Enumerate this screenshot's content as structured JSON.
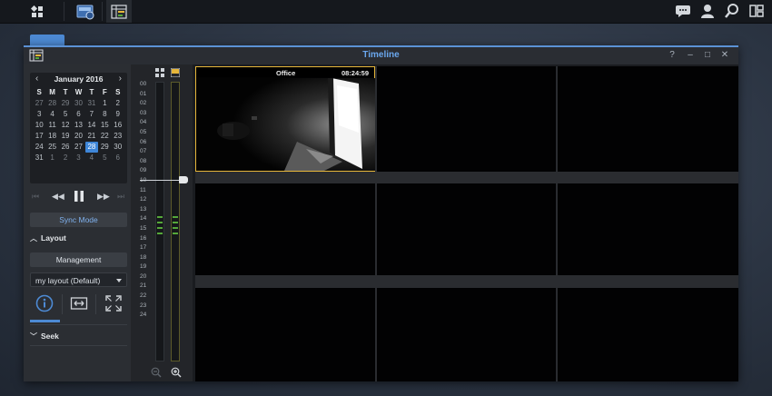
{
  "window": {
    "title": "Timeline"
  },
  "calendar": {
    "month_label": "January 2016",
    "prev": "‹",
    "next": "›",
    "day_headers": [
      "S",
      "M",
      "T",
      "W",
      "T",
      "F",
      "S"
    ],
    "weeks": [
      [
        "27",
        "28",
        "29",
        "30",
        "31",
        "1",
        "2"
      ],
      [
        "3",
        "4",
        "5",
        "6",
        "7",
        "8",
        "9"
      ],
      [
        "10",
        "11",
        "12",
        "13",
        "14",
        "15",
        "16"
      ],
      [
        "17",
        "18",
        "19",
        "20",
        "21",
        "22",
        "23"
      ],
      [
        "24",
        "25",
        "26",
        "27",
        "28",
        "29",
        "30"
      ],
      [
        "31",
        "1",
        "2",
        "3",
        "4",
        "5",
        "6"
      ]
    ],
    "selected_day": "28"
  },
  "controls": {
    "sync_mode": "Sync Mode",
    "layout_section": "Layout",
    "management": "Management",
    "layout_select": "my layout (Default)",
    "seek_section": "Seek"
  },
  "timeline": {
    "hours": [
      "00",
      "01",
      "02",
      "03",
      "04",
      "05",
      "06",
      "07",
      "08",
      "09",
      "10",
      "11",
      "12",
      "13",
      "14",
      "15",
      "16",
      "17",
      "18",
      "19",
      "20",
      "21",
      "22",
      "23",
      "24"
    ]
  },
  "camera": {
    "name": "Office",
    "time": "08:24:59"
  },
  "colors": {
    "accent": "#4d8ad4",
    "selection": "#e6b63a",
    "recording": "#56a83a"
  }
}
